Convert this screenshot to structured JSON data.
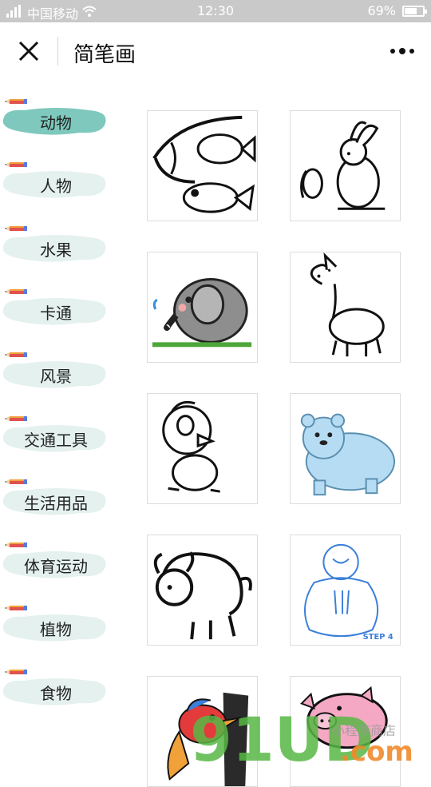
{
  "status": {
    "carrier": "中国移动",
    "time": "12:30",
    "battery": "69%",
    "battery_level": 0.69
  },
  "nav": {
    "title": "简笔画"
  },
  "categories": [
    {
      "label": "动物",
      "active": true
    },
    {
      "label": "人物",
      "active": false
    },
    {
      "label": "水果",
      "active": false
    },
    {
      "label": "卡通",
      "active": false
    },
    {
      "label": "风景",
      "active": false
    },
    {
      "label": "交通工具",
      "active": false
    },
    {
      "label": "生活用品",
      "active": false
    },
    {
      "label": "体育运动",
      "active": false
    },
    {
      "label": "植物",
      "active": false
    },
    {
      "label": "食物",
      "active": false
    }
  ],
  "images": [
    {
      "subject": "fish",
      "caption": ""
    },
    {
      "subject": "rabbits",
      "caption": ""
    },
    {
      "subject": "elephant",
      "caption": ""
    },
    {
      "subject": "alpaca",
      "caption": ""
    },
    {
      "subject": "bird",
      "caption": ""
    },
    {
      "subject": "polar-bear",
      "caption": ""
    },
    {
      "subject": "buffalo",
      "caption": ""
    },
    {
      "subject": "monk",
      "caption": "STEP 4"
    },
    {
      "subject": "woodpecker",
      "caption": ""
    },
    {
      "subject": "pig",
      "caption": ""
    }
  ],
  "watermark": {
    "text": "91UD",
    "suffix": ".com",
    "chinese": "小程序商店"
  },
  "colors": {
    "status_bar": "#c9c9c9",
    "active_blob": "#7ec8bd",
    "inactive_blob": "#e4f1ef",
    "accent_green": "#58b845"
  }
}
